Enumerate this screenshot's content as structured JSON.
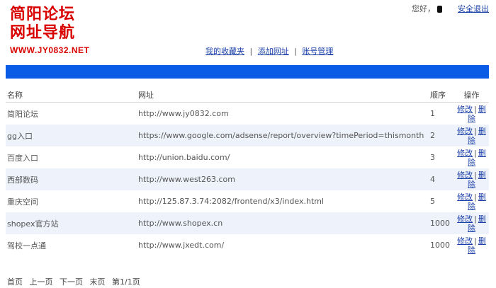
{
  "logo": {
    "line1": "简阳论坛",
    "line2": "网址导航",
    "url": "WWW.JY0832.NET"
  },
  "user": {
    "greeting": "您好，",
    "logout": "安全退出"
  },
  "nav": [
    "我的收藏夹",
    "添加网址",
    "账号管理"
  ],
  "table": {
    "headers": {
      "name": "名称",
      "url": "网址",
      "order": "顺序",
      "actions": "操作"
    },
    "edit_label": "修改",
    "delete_label": "删除",
    "rows": [
      {
        "name": "简阳论坛",
        "url": "http://www.jy0832.com",
        "order": "1"
      },
      {
        "name": "gg入口",
        "url": "https://www.google.com/adsense/report/overview?timePeriod=thismonth",
        "order": "2"
      },
      {
        "name": "百度入口",
        "url": "http://union.baidu.com/",
        "order": "3"
      },
      {
        "name": "西部数码",
        "url": "http://www.west263.com",
        "order": "4"
      },
      {
        "name": "重庆空间",
        "url": "http://125.87.3.74:2082/frontend/x3/index.html",
        "order": "5"
      },
      {
        "name": "shopex官方站",
        "url": "http://www.shopex.cn",
        "order": "1000"
      },
      {
        "name": "驾校一点通",
        "url": "http://www.jxedt.com/",
        "order": "1000"
      }
    ]
  },
  "pager": {
    "first": "首页",
    "prev": "上一页",
    "next": "下一页",
    "last": "末页",
    "info": "第1/1页"
  },
  "colors": {
    "bar": "#0a5ce6",
    "logo": "#d90000",
    "link": "#1a3fa8",
    "row_alt": "#eef2fb"
  }
}
